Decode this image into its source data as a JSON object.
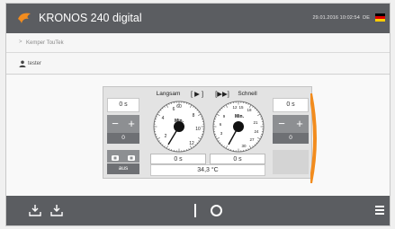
{
  "header": {
    "title": "KRONOS 240 digital",
    "datetime": "29.01.2016 10:02:54",
    "lang": "DE",
    "colors": {
      "bar": "#5b5d61",
      "accent": "#f28c1e"
    }
  },
  "breadcrumb": {
    "icon": "arrow-right-icon",
    "text": "Kemper TouTek"
  },
  "user": {
    "icon": "user-icon",
    "name": "tester"
  },
  "device": {
    "left": {
      "time_value": "0 s",
      "minus_label": "−",
      "plus_label": "+",
      "count_value": "0",
      "mode_label": "aus"
    },
    "slow": {
      "label": "Langsam",
      "button_label": "[ ▶ ]",
      "dial_unit": "Min.",
      "dial_ticks": [
        "60",
        "2",
        "4",
        "6",
        "8",
        "10",
        "12"
      ],
      "time_value": "0 s"
    },
    "fast": {
      "label": "Schnell",
      "button_label": "[▶▶]",
      "dial_unit": "Min.",
      "dial_ticks": [
        "12",
        "15",
        "18",
        "21",
        "24",
        "27",
        "30",
        "3",
        "6",
        "9"
      ],
      "time_value": "0 s"
    },
    "right": {
      "time_value": "0 s",
      "minus_label": "−",
      "plus_label": "+",
      "count_value": "0"
    },
    "temperature": "34,3 °C"
  },
  "footer": {
    "left_icons": [
      "tray-down-icon",
      "tray-down-icon"
    ],
    "stop_label": "I",
    "start_label": "O",
    "menu_icon": "menu-icon"
  }
}
